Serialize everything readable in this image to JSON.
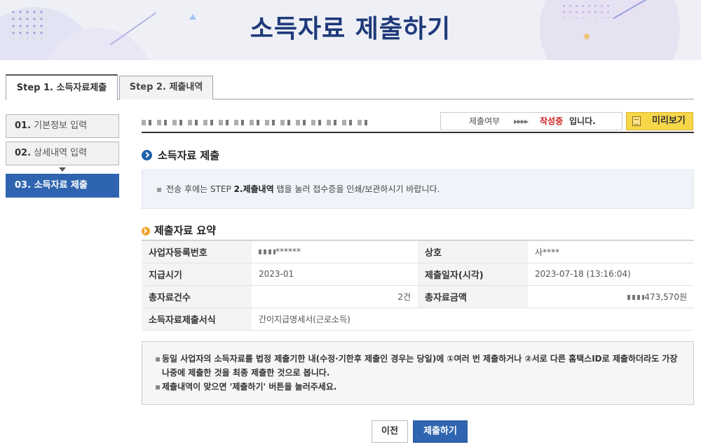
{
  "page": {
    "title": "소득자료 제출하기"
  },
  "tabs": [
    {
      "label": "Step 1. 소득자료제출",
      "active": true
    },
    {
      "label": "Step 2. 제출내역",
      "active": false
    }
  ],
  "steps": [
    {
      "num": "01.",
      "label": "기본정보 입력"
    },
    {
      "num": "02.",
      "label": "상세내역 입력"
    },
    {
      "num": "03.",
      "label": "소득자료 제출"
    }
  ],
  "status": {
    "label": "제출여부",
    "arrows": "▸▸▸▸",
    "state": "작성중",
    "suffix": "입니다.",
    "state_color": "#d21e1e"
  },
  "preview_button": {
    "label": "미리보기",
    "icon": "document-icon"
  },
  "section1": {
    "title": "소득자료 제출",
    "notice_prefix": "전송 후에는 STEP ",
    "notice_bold": "2.제출내역",
    "notice_suffix": " 탭을 눌러 접수증을 인쇄/보관하시기 바랍니다."
  },
  "section2": {
    "title": "제출자료 요약",
    "rows": [
      {
        "k1": "사업자등록번호",
        "v1": "******",
        "k2": "상호",
        "v2": "사****"
      },
      {
        "k1": "지급시기",
        "v1": "2023-01",
        "k2": "제출일자(시각)",
        "v2": "2023-07-18 (13:16:04)"
      },
      {
        "k1": "총자료건수",
        "v1": "2건",
        "k2": "총자료금액",
        "v2": "473,570원"
      },
      {
        "k1": "소득자료제출서식",
        "v1": "간이지급명세서(근로소득)"
      }
    ]
  },
  "notice2": {
    "line1": "동일 사업자의 소득자료를 법정 제출기한 내(수정·기한후 제출인 경우는 당일)에 ①여러 번 제출하거나 ②서로 다른 홈택스ID로 제출하더라도 가장 나중에 제출한 것을 최종 제출한 것으로 봅니다.",
    "line2": "제출내역이 맞으면 '제출하기' 버튼을 눌러주세요."
  },
  "buttons": {
    "prev": "이전",
    "submit": "제출하기"
  },
  "colors": {
    "brand_blue": "#2f65b0",
    "title_navy": "#1f3a7a",
    "preview_yellow": "#f6d74a"
  }
}
